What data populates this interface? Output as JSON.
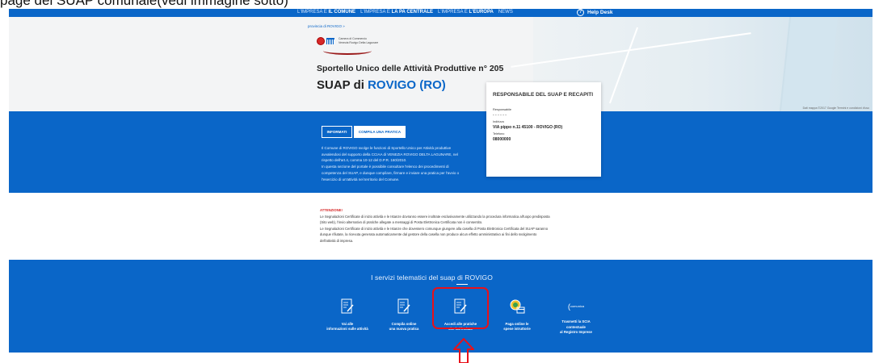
{
  "caption": "page del SUAP  comunale(vedi immagine sotto)",
  "nav": {
    "items": [
      {
        "prefix": "L'IMPRESA E ",
        "strong": "IL COMUNE"
      },
      {
        "prefix": "L'IMPRESA E ",
        "strong": "LA PA CENTRALE"
      },
      {
        "prefix": "L'IMPRESA E ",
        "strong": "L'EUROPA"
      },
      {
        "prefix": "NEWS",
        "strong": ""
      }
    ],
    "helpdesk": "Help Desk"
  },
  "breadcrumb": "provincia di ROVIGO »",
  "logo": {
    "line1": "Camera di Commercio",
    "line2": "Venezia Rovigo Delta Lagunare"
  },
  "subtitle": "Sportello Unico delle Attività Produttive n° 205",
  "title_prefix": "SUAP di ",
  "title_city": "ROVIGO (RO)",
  "map_credit": "Dati mappa ©2017 Google   Termini e condizioni d'uso",
  "tabs": {
    "informati": "INFORMATI",
    "compila": "COMPILA UNA PRATICA"
  },
  "intro": [
    "Il Comune di ROVIGO svolge le funzioni di Sportello Unico per Attività produttive",
    "avvalendosi del supporto della CCIAA di VENEZIA ROVIGO DELTA LAGUNARE, nel",
    "rispetto dell'art.4, comma 10-12 del D.P.R. 160/2010.",
    "In questa sezione del portale è possibile consultare l'elenco dei procedimenti di",
    "competenza del SUAP, e dunque compilare, firmare e inviare una pratica per l'avvio o",
    "l'esercizio di un'attività nel territorio del Comune."
  ],
  "card": {
    "heading": "RESPONSABILE DEL SUAP E RECAPITI",
    "responsabile_label": "Responsabile",
    "responsabile_value": "- - - - - -",
    "indirizzo_label": "Indirizzo",
    "indirizzo_value": "VIA pippo n.11 45100 - ROVIGO (RO)",
    "telefono_label": "Telefono",
    "telefono_value": "08000000"
  },
  "attention": {
    "title": "ATTENZIONE!",
    "lines": [
      "Le Segnalazioni Certificate di inizio attività e le Istanze dovranno essere inoltrate esclusivamente utilizzando la procedura informatica all'uopo predisposta",
      "(Sito web), l'invio alternativo di pratiche allegate a messaggi di Posta Elettronica Certificata non è consentito.",
      "Le Segnalazioni Certificate di inizio attività e le Istanze che dovessero comunque giungere alla casella di Posta Elettronica Certificata del SUAP saranno",
      "dunque rifiutate, la ricevuta generata automaticamente dal gestore della casella non produce alcun effetto amministrativo ai fini dello svolgimento",
      "dell'attività di impresa."
    ]
  },
  "services": {
    "title": "I servizi telematici del suap di ROVIGO",
    "items": [
      {
        "icon": "document-edit-icon",
        "line1": "Vai alle",
        "line2": "informazioni sulle attività"
      },
      {
        "icon": "document-edit-icon",
        "line1": "Compila online",
        "line2": "una nuova pratica"
      },
      {
        "icon": "document-edit-icon",
        "line1": "Accedi alle pratiche",
        "line2": "che hai inviato"
      },
      {
        "icon": "payment-icon",
        "line1": "Paga online le",
        "line2": "spese istruttorie"
      },
      {
        "icon": "comunica-icon",
        "line1": "Trasmetti la SCIA contestuale",
        "line2": "al Registro Imprese"
      }
    ],
    "comunica_small": "comunica"
  },
  "colors": {
    "brand": "#0a66c8",
    "highlight": "#e8111a",
    "alert": "#d62828"
  }
}
